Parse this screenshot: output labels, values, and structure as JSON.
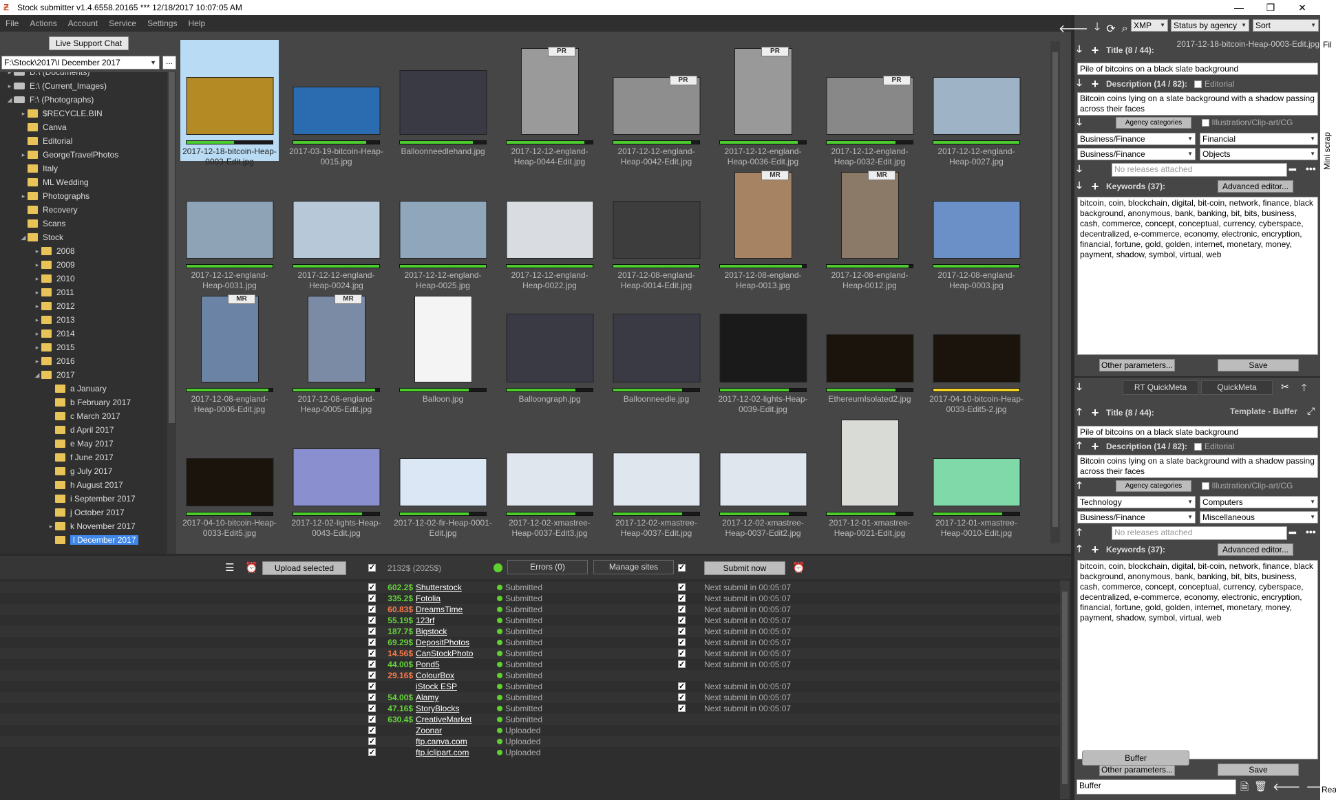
{
  "window": {
    "title": "Stock submitter v1.4.6558.20165 *** 12/18/2017 10:07:05 AM"
  },
  "menu": [
    "File",
    "Actions",
    "Account",
    "Service",
    "Settings",
    "Help"
  ],
  "live_chat": "Live Support Chat",
  "path": "F:\\Stock\\2017\\l December 2017",
  "path_btn": "...",
  "tree": [
    {
      "label": "D:\\ (Documents)",
      "level": 0,
      "type": "drive",
      "exp": "▸"
    },
    {
      "label": "E:\\ (Current_Images)",
      "level": 0,
      "type": "drive",
      "exp": "▸"
    },
    {
      "label": "F:\\ (Photographs)",
      "level": 0,
      "type": "drive",
      "exp": "◢"
    },
    {
      "label": "$RECYCLE.BIN",
      "level": 1,
      "type": "folder",
      "exp": "▸"
    },
    {
      "label": "Canva",
      "level": 1,
      "type": "folder",
      "exp": ""
    },
    {
      "label": "Editorial",
      "level": 1,
      "type": "folder",
      "exp": ""
    },
    {
      "label": "GeorgeTravelPhotos",
      "level": 1,
      "type": "folder",
      "exp": "▸"
    },
    {
      "label": "Italy",
      "level": 1,
      "type": "folder",
      "exp": ""
    },
    {
      "label": "ML Wedding",
      "level": 1,
      "type": "folder",
      "exp": ""
    },
    {
      "label": "Photographs",
      "level": 1,
      "type": "folder",
      "exp": "▸"
    },
    {
      "label": "Recovery",
      "level": 1,
      "type": "folder",
      "exp": ""
    },
    {
      "label": "Scans",
      "level": 1,
      "type": "folder",
      "exp": ""
    },
    {
      "label": "Stock",
      "level": 1,
      "type": "folder",
      "exp": "◢"
    },
    {
      "label": "2008",
      "level": 2,
      "type": "folder",
      "exp": "▸"
    },
    {
      "label": "2009",
      "level": 2,
      "type": "folder",
      "exp": "▸"
    },
    {
      "label": "2010",
      "level": 2,
      "type": "folder",
      "exp": "▸"
    },
    {
      "label": "2011",
      "level": 2,
      "type": "folder",
      "exp": "▸"
    },
    {
      "label": "2012",
      "level": 2,
      "type": "folder",
      "exp": "▸"
    },
    {
      "label": "2013",
      "level": 2,
      "type": "folder",
      "exp": "▸"
    },
    {
      "label": "2014",
      "level": 2,
      "type": "folder",
      "exp": "▸"
    },
    {
      "label": "2015",
      "level": 2,
      "type": "folder",
      "exp": "▸"
    },
    {
      "label": "2016",
      "level": 2,
      "type": "folder",
      "exp": "▸"
    },
    {
      "label": "2017",
      "level": 2,
      "type": "folder",
      "exp": "◢"
    },
    {
      "label": "a January",
      "level": 3,
      "type": "folder",
      "exp": ""
    },
    {
      "label": "b February 2017",
      "level": 3,
      "type": "folder",
      "exp": ""
    },
    {
      "label": "c March 2017",
      "level": 3,
      "type": "folder",
      "exp": ""
    },
    {
      "label": "d April 2017",
      "level": 3,
      "type": "folder",
      "exp": ""
    },
    {
      "label": "e May 2017",
      "level": 3,
      "type": "folder",
      "exp": ""
    },
    {
      "label": "f June 2017",
      "level": 3,
      "type": "folder",
      "exp": ""
    },
    {
      "label": "g July 2017",
      "level": 3,
      "type": "folder",
      "exp": ""
    },
    {
      "label": "h August 2017",
      "level": 3,
      "type": "folder",
      "exp": ""
    },
    {
      "label": "i September 2017",
      "level": 3,
      "type": "folder",
      "exp": ""
    },
    {
      "label": "j October 2017",
      "level": 3,
      "type": "folder",
      "exp": ""
    },
    {
      "label": "k November 2017",
      "level": 3,
      "type": "folder",
      "exp": "▸"
    },
    {
      "label": "l December 2017",
      "level": 3,
      "type": "folder",
      "exp": "",
      "selected": true
    }
  ],
  "thumbs": [
    {
      "name": "2017-12-18-bitcoin-Heap-0003-Edit.jpg",
      "selected": true,
      "color": "#b48a25",
      "w": 127,
      "h": 84,
      "prog": 0.55,
      "badge": ""
    },
    {
      "name": "2017-03-19-bitcoin-Heap-0015.jpg",
      "color": "#2b6cb0",
      "w": 127,
      "h": 70,
      "prog": 0.85,
      "badge": ""
    },
    {
      "name": "Balloonneedlehand.jpg",
      "color": "#3a3a45",
      "w": 127,
      "h": 94,
      "prog": 0.85,
      "badge": ""
    },
    {
      "name": "2017-12-12-england-Heap-0044-Edit.jpg",
      "color": "#9a9a9a",
      "w": 84,
      "h": 126,
      "prog": 0.9,
      "badge": "PR"
    },
    {
      "name": "2017-12-12-england-Heap-0042-Edit.jpg",
      "color": "#8e8e8e",
      "w": 127,
      "h": 84,
      "prog": 0.9,
      "badge": "PR"
    },
    {
      "name": "2017-12-12-england-Heap-0036-Edit.jpg",
      "color": "#999",
      "w": 84,
      "h": 126,
      "prog": 0.9,
      "badge": "PR"
    },
    {
      "name": "2017-12-12-england-Heap-0032-Edit.jpg",
      "color": "#888",
      "w": 127,
      "h": 84,
      "prog": 0.8,
      "badge": "PR"
    },
    {
      "name": "2017-12-12-england-Heap-0027.jpg",
      "color": "#9fb3c6",
      "w": 127,
      "h": 84,
      "prog": 1.0,
      "badge": ""
    },
    {
      "name": "2017-12-12-england-Heap-0031.jpg",
      "color": "#8ea3b6",
      "w": 127,
      "h": 84,
      "prog": 1.0,
      "badge": ""
    },
    {
      "name": "2017-12-12-england-Heap-0024.jpg",
      "color": "#b7c8d8",
      "w": 127,
      "h": 84,
      "prog": 1.0,
      "badge": ""
    },
    {
      "name": "2017-12-12-england-Heap-0025.jpg",
      "color": "#8fa6bb",
      "w": 127,
      "h": 84,
      "prog": 1.0,
      "badge": ""
    },
    {
      "name": "2017-12-12-england-Heap-0022.jpg",
      "color": "#d9dde2",
      "w": 127,
      "h": 84,
      "prog": 1.0,
      "badge": ""
    },
    {
      "name": "2017-12-08-england-Heap-0014-Edit.jpg",
      "color": "#3d3d3d",
      "w": 127,
      "h": 84,
      "prog": 1.0,
      "badge": ""
    },
    {
      "name": "2017-12-08-england-Heap-0013.jpg",
      "color": "#a58363",
      "w": 84,
      "h": 126,
      "prog": 0.95,
      "badge": "MR"
    },
    {
      "name": "2017-12-08-england-Heap-0012.jpg",
      "color": "#8c7a68",
      "w": 84,
      "h": 126,
      "prog": 0.95,
      "badge": "MR"
    },
    {
      "name": "2017-12-08-england-Heap-0003.jpg",
      "color": "#6b8fc7",
      "w": 127,
      "h": 84,
      "prog": 1.0,
      "badge": ""
    },
    {
      "name": "2017-12-08-england-Heap-0006-Edit.jpg",
      "color": "#6b84a5",
      "w": 84,
      "h": 126,
      "prog": 0.95,
      "badge": "MR"
    },
    {
      "name": "2017-12-08-england-Heap-0005-Edit.jpg",
      "color": "#7b8ba5",
      "w": 84,
      "h": 126,
      "prog": 0.95,
      "badge": "MR"
    },
    {
      "name": "Balloon.jpg",
      "color": "#f4f4f4",
      "w": 84,
      "h": 126,
      "prog": 0.8,
      "badge": ""
    },
    {
      "name": "Balloongraph.jpg",
      "color": "#3a3a45",
      "w": 127,
      "h": 100,
      "prog": 0.8,
      "badge": ""
    },
    {
      "name": "Balloonneedle.jpg",
      "color": "#3a3a45",
      "w": 127,
      "h": 100,
      "prog": 0.8,
      "badge": ""
    },
    {
      "name": "2017-12-02-lights-Heap-0039-Edit.jpg",
      "color": "#1a1a1a",
      "w": 127,
      "h": 100,
      "prog": 0.8,
      "badge": ""
    },
    {
      "name": "EthereumIsolated2.jpg",
      "color": "#1a140c",
      "w": 127,
      "h": 70,
      "prog": 0.8,
      "badge": ""
    },
    {
      "name": "2017-04-10-bitcoin-Heap-0033-Edit5-2.jpg",
      "color": "#1a140c",
      "w": 127,
      "h": 70,
      "prog": 1.0,
      "badge": "",
      "yellow": true
    },
    {
      "name": "2017-04-10-bitcoin-Heap-0033-Edit5.jpg",
      "color": "#1a140c",
      "w": 127,
      "h": 70,
      "prog": 0.75,
      "badge": ""
    },
    {
      "name": "2017-12-02-lights-Heap-0043-Edit.jpg",
      "color": "#8a8fcf",
      "w": 127,
      "h": 84,
      "prog": 0.8,
      "badge": ""
    },
    {
      "name": "2017-12-02-fir-Heap-0001-Edit.jpg",
      "color": "#dbe7f4",
      "w": 127,
      "h": 70,
      "prog": 0.8,
      "badge": ""
    },
    {
      "name": "2017-12-02-xmastree-Heap-0037-Edit3.jpg",
      "color": "#dfe6ee",
      "w": 127,
      "h": 78,
      "prog": 0.8,
      "badge": ""
    },
    {
      "name": "2017-12-02-xmastree-Heap-0037-Edit.jpg",
      "color": "#dfe6ee",
      "w": 127,
      "h": 78,
      "prog": 0.8,
      "badge": ""
    },
    {
      "name": "2017-12-02-xmastree-Heap-0037-Edit2.jpg",
      "color": "#dfe6ee",
      "w": 127,
      "h": 78,
      "prog": 0.8,
      "badge": ""
    },
    {
      "name": "2017-12-01-xmastree-Heap-0021-Edit.jpg",
      "color": "#d9dbd7",
      "w": 84,
      "h": 126,
      "prog": 0.8,
      "badge": ""
    },
    {
      "name": "2017-12-01-xmastree-Heap-0010-Edit.jpg",
      "color": "#7fd9a8",
      "w": 127,
      "h": 70,
      "prog": 0.8,
      "badge": ""
    }
  ],
  "top_right_toolbar": {
    "xmp": "XMP",
    "status": "Status by agency",
    "sort": "Sort"
  },
  "meta": {
    "filename": "2017-12-18-bitcoin-Heap-0003-Edit.jpg",
    "title_label": "Title (8 / 44):",
    "title": "Pile of bitcoins on a black slate background",
    "desc_label": "Description (14 / 82):",
    "editorial": "Editorial",
    "description": "Bitcoin coins lying on a slate background with a shadow passing across their faces",
    "agency_categories": "Agency categories",
    "illustration": "Illustration/Clip-art/CG",
    "cat1": "Business/Finance",
    "cat2": "Financial",
    "cat3": "Business/Finance",
    "cat4": "Objects",
    "releases_placeholder": "No releases attached",
    "keywords_label": "Keywords (37):",
    "advanced_editor": "Advanced editor...",
    "keywords": "bitcoin, coin, blockchain, digital, bit-coin, network, finance, black background, anonymous, bank, banking, bit, bits, business, cash, commerce, concept, conceptual, currency, cyberspace, decentralized, e-commerce, economy, electronic, encryption, financial, fortune, gold, golden, internet, monetary, money, payment, shadow, symbol, virtual, web",
    "other_params": "Other parameters...",
    "save": "Save"
  },
  "quickmeta": {
    "rt": "RT QuickMeta",
    "qm": "QuickMeta"
  },
  "template": {
    "label": "Template - Buffer",
    "title_label": "Title (8 / 44):",
    "title": "Pile of bitcoins on a black slate background",
    "desc_label": "Description (14 / 82):",
    "editorial": "Editorial",
    "description": "Bitcoin coins lying on a slate background with a shadow passing across their faces",
    "agency_categories": "Agency categories",
    "illustration": "Illustration/Clip-art/CG",
    "cat1": "Technology",
    "cat2": "Computers",
    "cat3": "Business/Finance",
    "cat4": "Miscellaneous",
    "releases_placeholder": "No releases attached",
    "keywords_label": "Keywords (37):",
    "advanced_editor": "Advanced editor...",
    "keywords": "bitcoin, coin, blockchain, digital, bit-coin, network, finance, black background, anonymous, bank, banking, bit, bits, business, cash, commerce, concept, conceptual, currency, cyberspace, decentralized, e-commerce, economy, electronic, encryption, financial, fortune, gold, golden, internet, monetary, money, payment, shadow, symbol, virtual, web",
    "other_params": "Other parameters...",
    "save": "Save",
    "buffer_btn": "Buffer",
    "buffer_field": "Buffer"
  },
  "side_tabs": {
    "mini": "Mini scrap",
    "fil": "Fil",
    "rea": "Rea"
  },
  "upload": {
    "upload_selected": "Upload selected",
    "total": "2132$ (2025$)",
    "errors": "Errors (0)",
    "manage_sites": "Manage sites",
    "submit_now": "Submit now"
  },
  "sites": [
    {
      "amount": "602.2$",
      "amt_color": "#66d43a",
      "name": "Shutterstock",
      "status": "Submitted",
      "next": "Next submit in 00:05:07",
      "chk2": true
    },
    {
      "amount": "335.2$",
      "amt_color": "#66d43a",
      "name": "Fotolia",
      "status": "Submitted",
      "next": "Next submit in 00:05:07",
      "chk2": true
    },
    {
      "amount": "60.83$",
      "amt_color": "#ff7a4a",
      "name": "DreamsTime",
      "status": "Submitted",
      "next": "Next submit in 00:05:07",
      "chk2": true
    },
    {
      "amount": "55.19$",
      "amt_color": "#66d43a",
      "name": "123rf",
      "status": "Submitted",
      "next": "Next submit in 00:05:07",
      "chk2": true
    },
    {
      "amount": "187.7$",
      "amt_color": "#66d43a",
      "name": "Bigstock",
      "status": "Submitted",
      "next": "Next submit in 00:05:07",
      "chk2": true
    },
    {
      "amount": "69.29$",
      "amt_color": "#66d43a",
      "name": "DepositPhotos",
      "status": "Submitted",
      "next": "Next submit in 00:05:07",
      "chk2": true
    },
    {
      "amount": "14.56$",
      "amt_color": "#ff7a4a",
      "name": "CanStockPhoto",
      "status": "Submitted",
      "next": "Next submit in 00:05:07",
      "chk2": true
    },
    {
      "amount": "44.00$",
      "amt_color": "#66d43a",
      "name": "Pond5",
      "status": "Submitted",
      "next": "Next submit in 00:05:07",
      "chk2": true
    },
    {
      "amount": "29.16$",
      "amt_color": "#ff7a4a",
      "name": "ColourBox",
      "status": "Submitted",
      "next": "",
      "chk2": false
    },
    {
      "amount": "",
      "amt_color": "#66d43a",
      "name": "iStock ESP",
      "status": "Submitted",
      "next": "Next submit in 00:05:07",
      "chk2": true
    },
    {
      "amount": "54.00$",
      "amt_color": "#66d43a",
      "name": "Alamy",
      "status": "Submitted",
      "next": "Next submit in 00:05:07",
      "chk2": true
    },
    {
      "amount": "47.16$",
      "amt_color": "#66d43a",
      "name": "StoryBlocks",
      "status": "Submitted",
      "next": "Next submit in 00:05:07",
      "chk2": true
    },
    {
      "amount": "630.4$",
      "amt_color": "#66d43a",
      "name": "CreativeMarket",
      "status": "Submitted",
      "next": "",
      "chk2": false
    },
    {
      "amount": "",
      "amt_color": "#66d43a",
      "name": "Zoonar",
      "status": "Uploaded",
      "next": "",
      "chk2": false
    },
    {
      "amount": "",
      "amt_color": "#66d43a",
      "name": "ftp.canva.com",
      "status": "Uploaded",
      "next": "",
      "chk2": false
    },
    {
      "amount": "",
      "amt_color": "#66d43a",
      "name": "ftp.iclipart.com",
      "status": "Uploaded",
      "next": "",
      "chk2": false
    }
  ]
}
